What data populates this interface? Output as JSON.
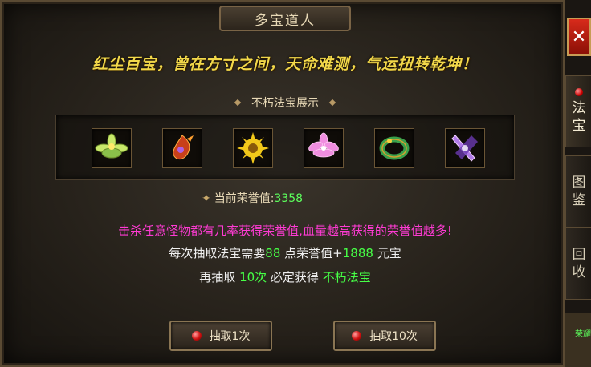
{
  "window": {
    "title": "多宝道人"
  },
  "slogan": "红尘百宝，曾在方寸之间，天命难测，气运扭转乾坤！",
  "showcase": {
    "header": "不朽法宝展示",
    "items": [
      {
        "name": "lotus-green-icon",
        "color": "#c8e86a"
      },
      {
        "name": "phoenix-pendant-icon",
        "color": "#e05a2a"
      },
      {
        "name": "sun-wheel-icon",
        "color": "#f2c81a"
      },
      {
        "name": "lotus-pink-icon",
        "color": "#f08ee0"
      },
      {
        "name": "jade-bracelet-icon",
        "color": "#3aa04a"
      },
      {
        "name": "crystal-blade-icon",
        "color": "#b07ae8"
      }
    ]
  },
  "honor": {
    "label": "当前荣誉值:",
    "value": "3358"
  },
  "info": {
    "line1": "击杀任意怪物都有几率获得荣誉值,血量越高获得的荣誉值越多!",
    "line2_pre": "每次抽取法宝需要",
    "line2_cost": "88",
    "line2_mid": " 点荣誉值+",
    "line2_gold": "1888",
    "line2_post": " 元宝",
    "line3_pre": "再抽取 ",
    "line3_count": "10次",
    "line3_mid": " 必定获得 ",
    "line3_reward": "不朽法宝"
  },
  "buttons": {
    "draw_one": "抽取1次",
    "draw_ten": "抽取10次"
  },
  "side_tabs": [
    {
      "label_top": "法",
      "label_bottom": "宝",
      "active": true
    },
    {
      "label_top": "图",
      "label_bottom": "鉴",
      "active": false
    },
    {
      "label_top": "回",
      "label_bottom": "收",
      "active": false
    }
  ],
  "close_label": "✕",
  "corner_text": "荣耀"
}
